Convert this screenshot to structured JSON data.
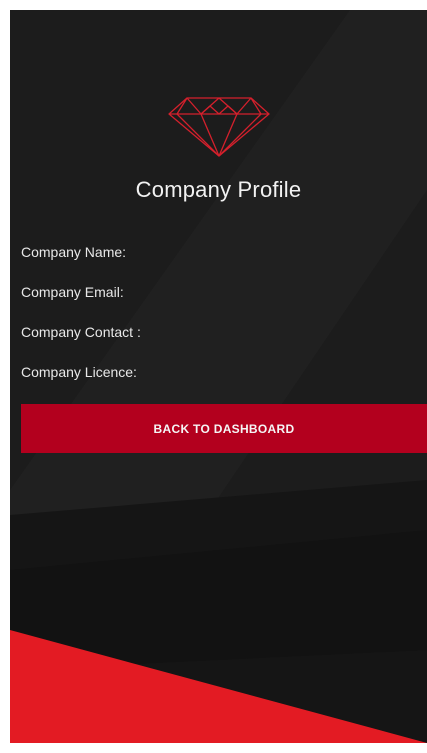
{
  "profile": {
    "title": "Company Profile",
    "fields": {
      "name_label": "Company Name:",
      "email_label": "Company Email:",
      "contact_label": "Company Contact :",
      "licence_label": "Company Licence:"
    },
    "back_button_label": "BACK TO DASHBOARD"
  },
  "logo": {
    "icon": "diamond-icon",
    "color": "#d4202c"
  },
  "colors": {
    "background": "#1c1c1c",
    "accent": "#b3001e",
    "red_band": "#e31b23",
    "text": "#eaeaea"
  }
}
